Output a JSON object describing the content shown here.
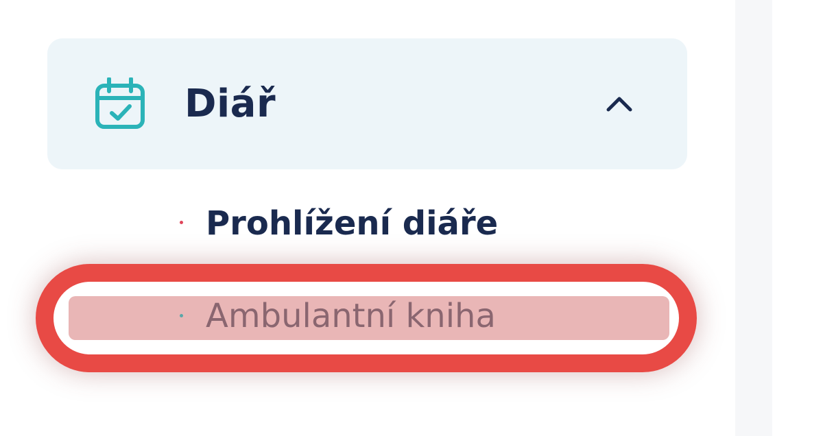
{
  "sidebar": {
    "group": {
      "label": "Diář",
      "icon": "calendar-check-icon",
      "expanded": true,
      "chevron_icon": "chevron-up-icon"
    },
    "items": [
      {
        "label": "Prohlížení diáře",
        "active": true
      },
      {
        "label": "Ambulantní kniha",
        "active": false,
        "highlighted": true
      }
    ]
  },
  "colors": {
    "accent_teal": "#2bb3b8",
    "text_dark": "#1a2a4f",
    "group_bg": "#edf5f9",
    "highlight_ring": "#e84a45",
    "highlight_fill": "#e9b6b6"
  }
}
